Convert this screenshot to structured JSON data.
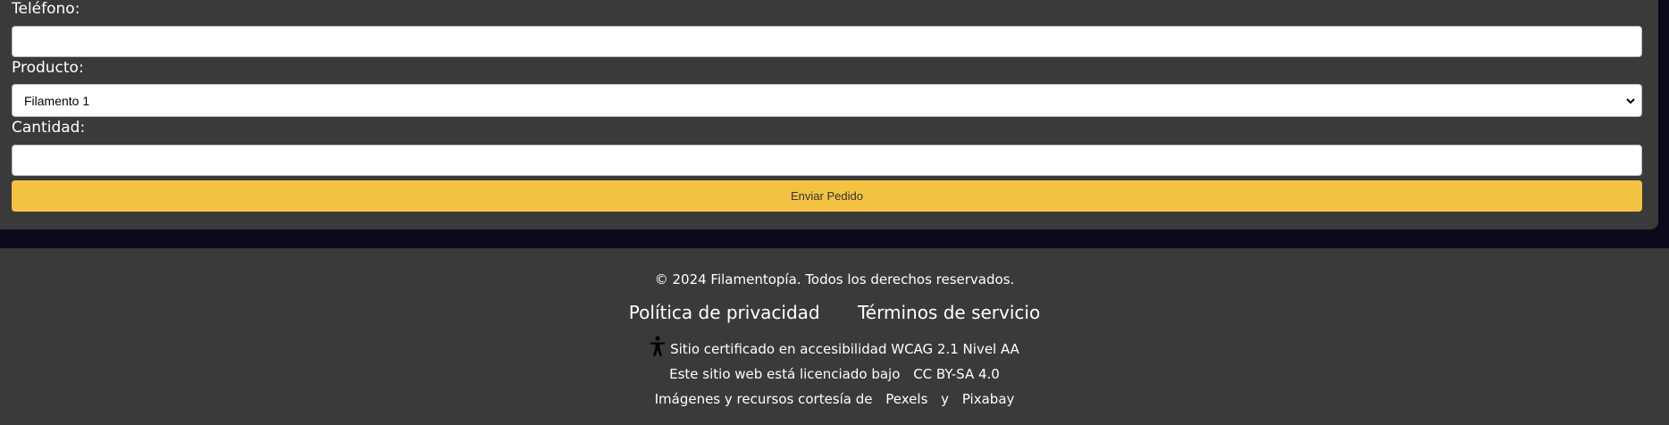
{
  "form": {
    "phone_label": "Teléfono:",
    "phone_value": "",
    "product_label": "Producto:",
    "product_selected": "Filamento 1",
    "quantity_label": "Cantidad:",
    "quantity_value": "",
    "submit_label": "Enviar Pedido"
  },
  "footer": {
    "copyright": "© 2024 Filamentopía. Todos los derechos reservados.",
    "privacy_link": "Política de privacidad",
    "terms_link": "Términos de servicio",
    "accessibility_icon": "accessibility-person-icon",
    "accessibility_text": "Sitio certificado en accesibilidad WCAG 2.1 Nivel AA",
    "license_text": "Este sitio web está licenciado bajo",
    "license_link": "CC BY-SA 4.0",
    "credits_text": "Imágenes y recursos cortesía de",
    "credits_link_1": "Pexels",
    "credits_and": "y",
    "credits_link_2": "Pixabay"
  },
  "colors": {
    "panel_bg": "#3a3a3a",
    "page_bg": "#0b0a1c",
    "accent": "#f3c242"
  }
}
